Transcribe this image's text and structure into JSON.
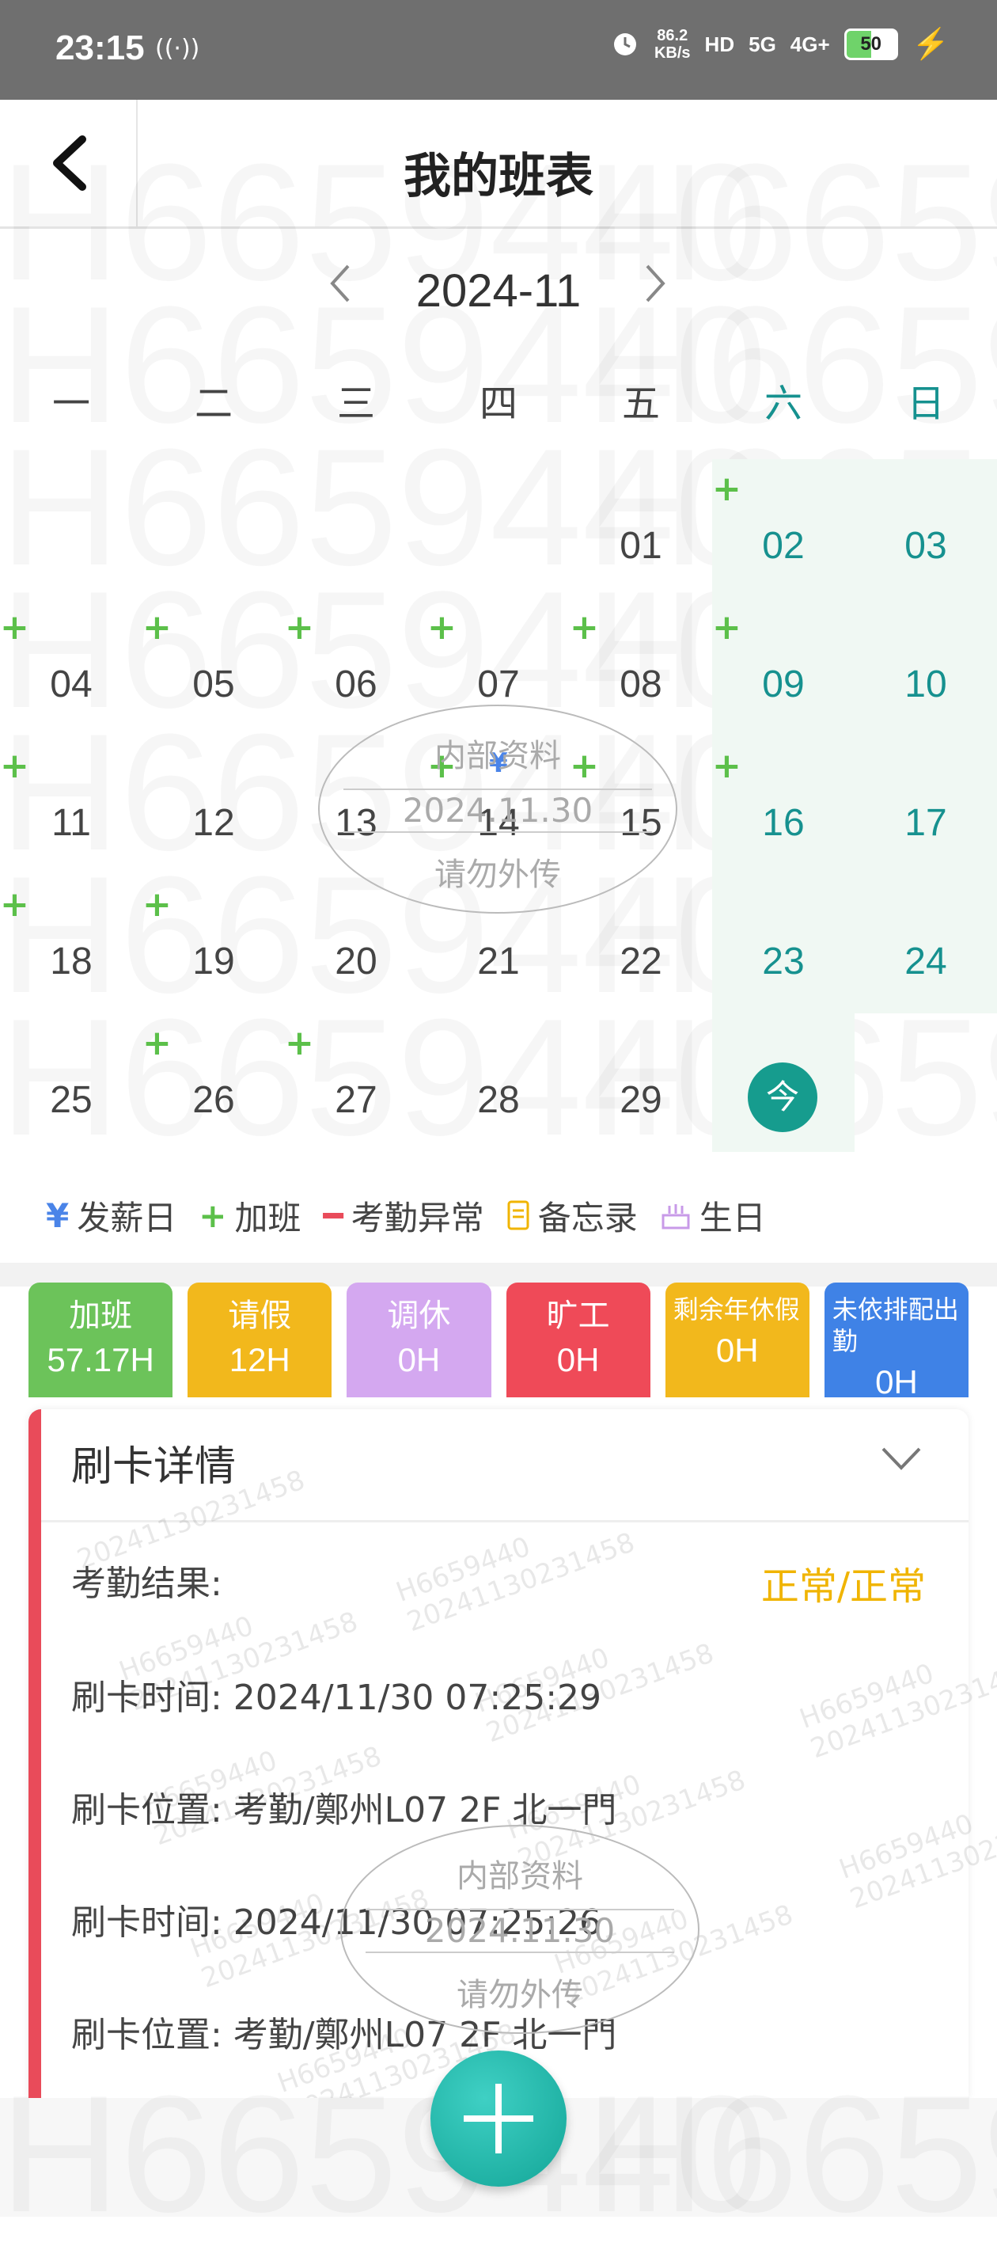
{
  "status_bar": {
    "time": "23:15",
    "signal_glyph": "((·))",
    "net_speed_value": "86.2",
    "net_speed_unit": "KB/s",
    "hd_label": "HD",
    "five_g": "5G",
    "four_g": "4G+",
    "battery": "50"
  },
  "header": {
    "title": "我的班表"
  },
  "calendar": {
    "month": "2024-11",
    "weekdays": [
      "一",
      "二",
      "三",
      "四",
      "五",
      "六",
      "日"
    ],
    "weeks": [
      [
        {
          "d": "",
          "plus": false
        },
        {
          "d": "",
          "plus": false
        },
        {
          "d": "",
          "plus": false
        },
        {
          "d": "",
          "plus": false
        },
        {
          "d": "01",
          "plus": false
        },
        {
          "d": "02",
          "plus": true
        },
        {
          "d": "03",
          "plus": false
        }
      ],
      [
        {
          "d": "04",
          "plus": true
        },
        {
          "d": "05",
          "plus": true
        },
        {
          "d": "06",
          "plus": true
        },
        {
          "d": "07",
          "plus": true
        },
        {
          "d": "08",
          "plus": true
        },
        {
          "d": "09",
          "plus": true
        },
        {
          "d": "10",
          "plus": false
        }
      ],
      [
        {
          "d": "11",
          "plus": true
        },
        {
          "d": "12",
          "plus": false
        },
        {
          "d": "13",
          "plus": false
        },
        {
          "d": "14",
          "plus": true,
          "yen": true
        },
        {
          "d": "15",
          "plus": true
        },
        {
          "d": "16",
          "plus": true
        },
        {
          "d": "17",
          "plus": false
        }
      ],
      [
        {
          "d": "18",
          "plus": true
        },
        {
          "d": "19",
          "plus": true
        },
        {
          "d": "20",
          "plus": false
        },
        {
          "d": "21",
          "plus": false
        },
        {
          "d": "22",
          "plus": false
        },
        {
          "d": "23",
          "plus": false
        },
        {
          "d": "24",
          "plus": false
        }
      ],
      [
        {
          "d": "25",
          "plus": false
        },
        {
          "d": "26",
          "plus": true
        },
        {
          "d": "27",
          "plus": true
        },
        {
          "d": "28",
          "plus": false
        },
        {
          "d": "29",
          "plus": false
        },
        {
          "d": "今",
          "plus": false,
          "today": true
        },
        {
          "d": "",
          "plus": false
        }
      ]
    ],
    "plus_glyph": "+",
    "yen_glyph": "¥"
  },
  "legend": {
    "payday": "发薪日",
    "overtime": "加班",
    "attendance_abnormal": "考勤异常",
    "memo": "备忘录",
    "birthday": "生日"
  },
  "stats": [
    {
      "label": "加班",
      "value": "57.17H",
      "color": "#6cc35a"
    },
    {
      "label": "请假",
      "value": "12H",
      "color": "#f2b81c"
    },
    {
      "label": "调休",
      "value": "0H",
      "color": "#d4a8f0"
    },
    {
      "label": "旷工",
      "value": "0H",
      "color": "#ef4a58"
    },
    {
      "label": "剩余年休假",
      "value": "0H",
      "color": "#f2b81c"
    },
    {
      "label": "未依排配出勤",
      "value": "0H",
      "color": "#3f82e6"
    }
  ],
  "punch_details": {
    "title": "刷卡详情",
    "result_label": "考勤结果:",
    "result_value": "正常/正常",
    "rows": [
      "刷卡时间: 2024/11/30 07:25:29",
      "刷卡位置: 考勤/鄭州L07 2F 北一門",
      "刷卡时间: 2024/11/30 07:25:26",
      "刷卡位置: 考勤/鄭州L07 2F 北一門"
    ]
  },
  "watermark": {
    "id": "H6659440",
    "code": "20241130231458",
    "stamp_top": "内部资料",
    "stamp_mid": "2024.11.30",
    "stamp_bottom": "请勿外传"
  },
  "colors": {
    "accent_teal": "#16918f",
    "overtime_green": "#5cc04a",
    "payday_blue": "#4a84e8",
    "alert_red": "#e94b5a"
  }
}
